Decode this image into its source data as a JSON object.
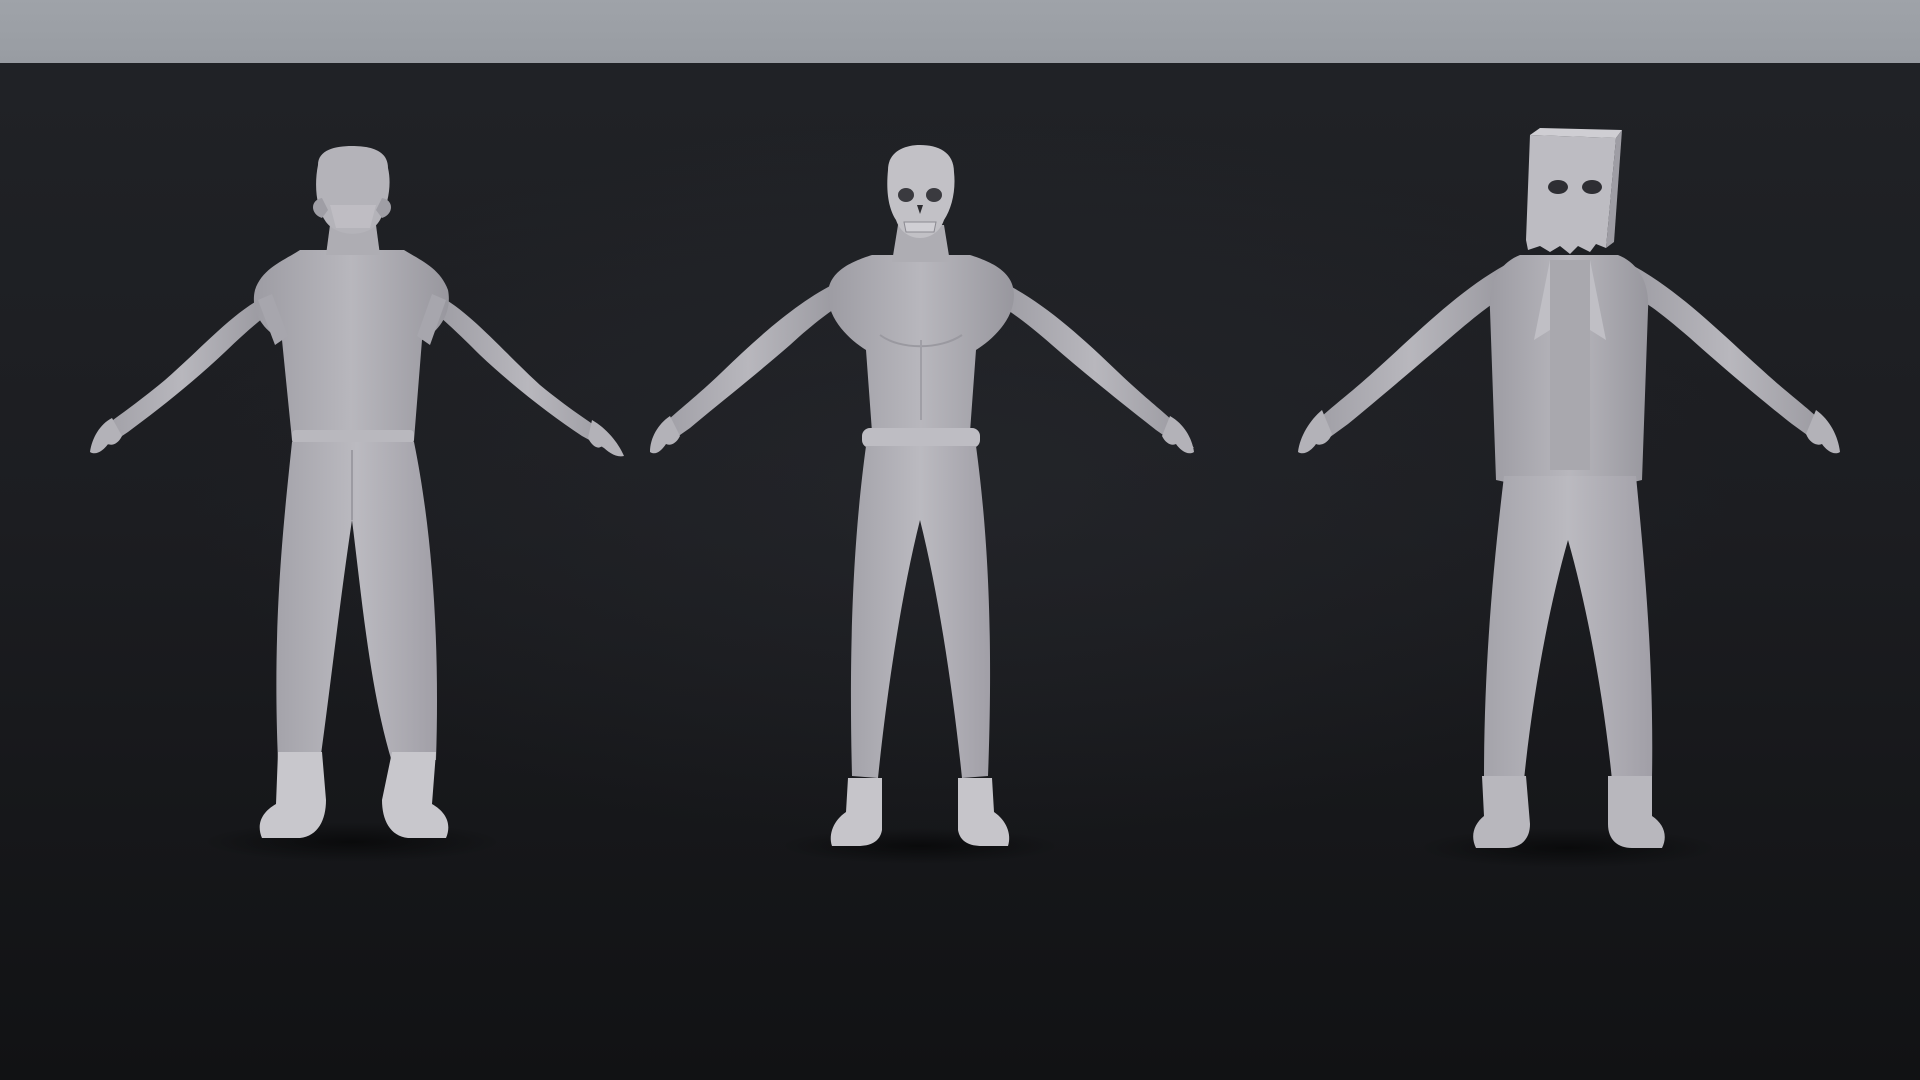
{
  "scene": {
    "colors": {
      "top_band": "#9fa3a9",
      "backdrop": "#1c1d21",
      "floor": "#111214",
      "model_light": "#b9b8be",
      "model_mid": "#a8a7ad",
      "model_shadow": "#8d8c93",
      "model_dark": "#2a2a2e"
    },
    "figures": [
      {
        "label_icon": "helmet-head-figure-icon"
      },
      {
        "label_icon": "skull-head-figure-icon"
      },
      {
        "label_icon": "paper-bag-head-figure-icon"
      }
    ]
  }
}
